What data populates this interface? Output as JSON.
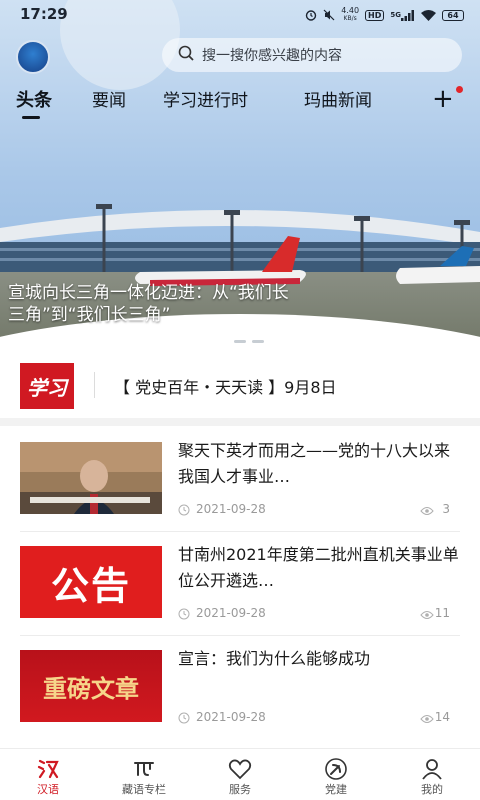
{
  "status_bar": {
    "time": "17:29",
    "network_speed": "4.40",
    "network_unit": "KB/s",
    "hd": "HD",
    "signal": "5G",
    "battery": "64"
  },
  "header": {
    "logo_icon": "app-logo-icon",
    "search_placeholder": "搜一搜你感兴趣的内容",
    "channels": [
      "头条",
      "要闻",
      "学习进行时",
      "玛曲新闻"
    ],
    "active_channel": 0,
    "add_channel": "+"
  },
  "hero": {
    "caption_line1": "宣城向长三角一体化迈进：从“我们长",
    "caption_line2": "三角”到“我们长三角”",
    "slide_count": 3,
    "active_slide": 0
  },
  "notice": {
    "logo_text": "学习",
    "text": "【 党史百年・天天读 】9月8日"
  },
  "news": [
    {
      "title": "聚天下英才而用之——党的十八大以来我国人才事业…",
      "date": "2021-09-28",
      "views": "3",
      "thumb_text": ""
    },
    {
      "title": "甘南州2021年度第二批州直机关事业单位公开遴选…",
      "date": "2021-09-28",
      "views": "11",
      "thumb_text": "公告"
    },
    {
      "title": "宣言：我们为什么能够成功",
      "date": "2021-09-28",
      "views": "14",
      "thumb_text": "重磅文章"
    }
  ],
  "bottom_nav": [
    {
      "label": "汉语",
      "icon": "han-language-icon",
      "active": true
    },
    {
      "label": "藏语专栏",
      "icon": "tibetan-language-icon",
      "active": false
    },
    {
      "label": "服务",
      "icon": "heart-icon",
      "active": false
    },
    {
      "label": "党建",
      "icon": "party-emblem-icon",
      "active": false
    },
    {
      "label": "我的",
      "icon": "user-icon",
      "active": false
    }
  ],
  "colors": {
    "accent": "#d01922",
    "nav_active": "#d01922"
  }
}
